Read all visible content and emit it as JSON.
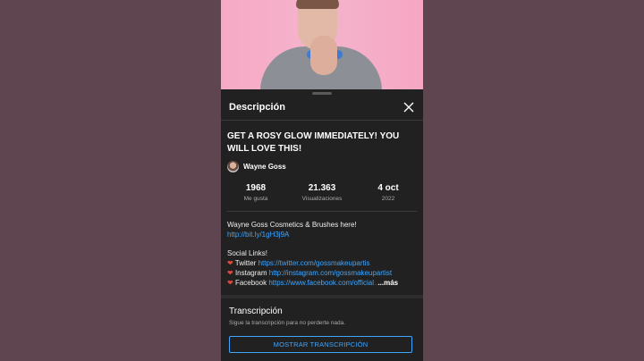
{
  "panel": {
    "header": "Descripción"
  },
  "video": {
    "title": "GET A ROSY GLOW IMMEDIATELY! YOU WILL LOVE THIS!",
    "channel": "Wayne Goss"
  },
  "stats": [
    {
      "value": "1968",
      "label": "Me gusta"
    },
    {
      "value": "21.363",
      "label": "Visualizaciones"
    },
    {
      "value": "4 oct",
      "label": "2022"
    }
  ],
  "description": {
    "line1": "Wayne Goss Cosmetics & Brushes here!",
    "link1": "http://bit.ly/1gH3j9A",
    "social_heading": "Social Links!",
    "twitter_label": "Twitter",
    "twitter_url": "https://twitter.com/gossmakeupartis",
    "instagram_label": "Instagram",
    "instagram_url": "http://instagram.com/gossmakeupartist",
    "facebook_label": "Facebook",
    "facebook_url": "https://www.facebook.com/official",
    "more": "...más"
  },
  "transcript": {
    "title": "Transcripción",
    "subtitle": "Sigue la transcripción para no perderte nada.",
    "button": "MOSTRAR TRANSCRIPCIÓN"
  },
  "colors": {
    "link": "#3ea6ff",
    "background": "#212121",
    "heart": "#e2463b"
  }
}
